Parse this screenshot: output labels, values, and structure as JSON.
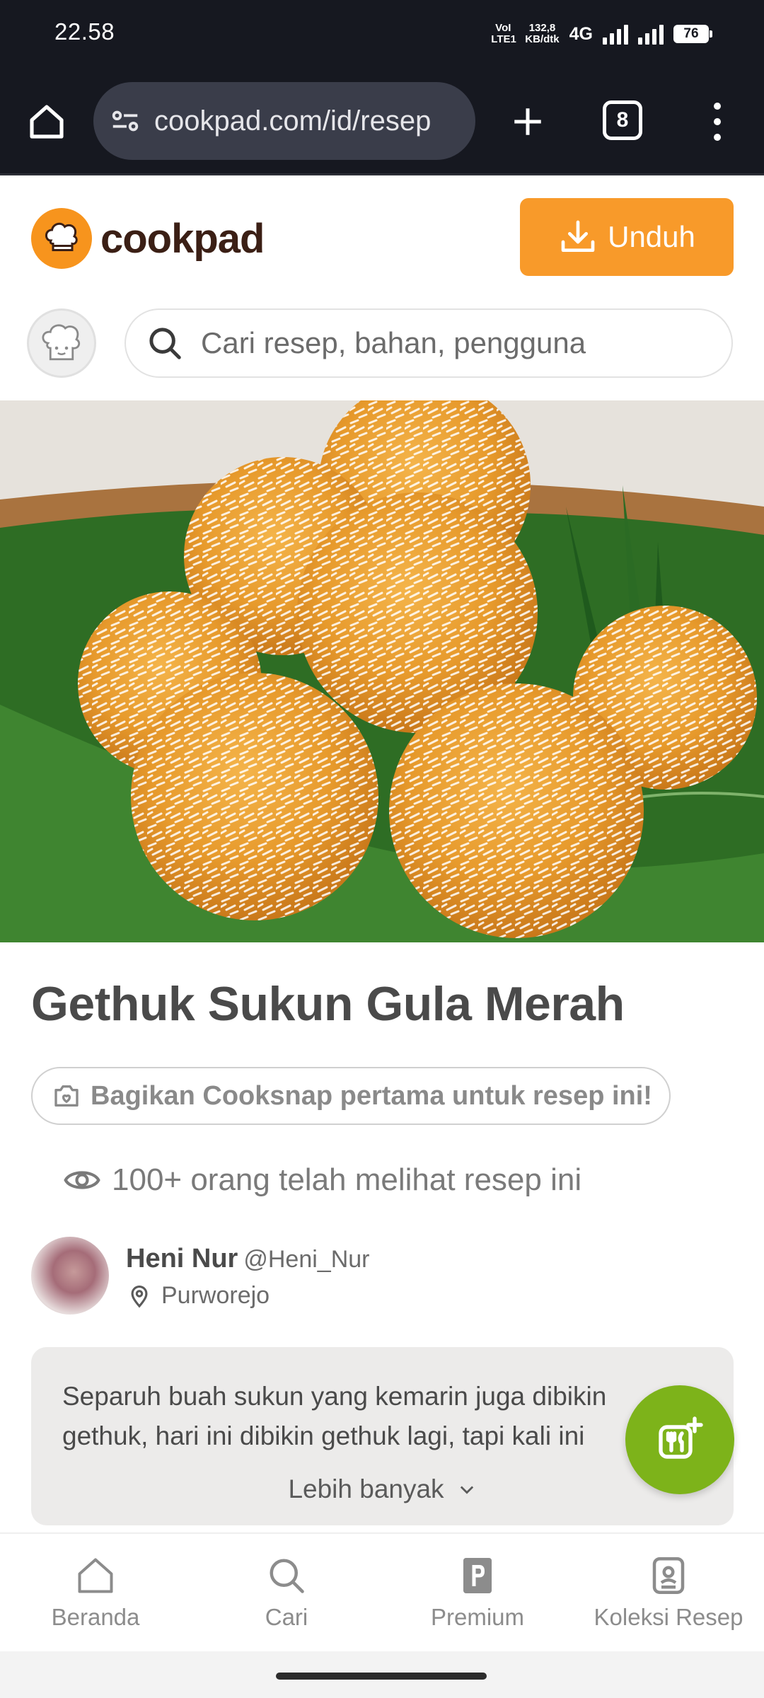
{
  "status_bar": {
    "time": "22.58",
    "volte": "VoI LTE1",
    "speed_value": "132,8",
    "speed_unit": "KB/dtk",
    "network": "4G",
    "battery": "76"
  },
  "browser": {
    "url": "cookpad.com/id/resep",
    "tab_count": "8"
  },
  "header": {
    "logo_text": "cookpad",
    "download_label": "Unduh",
    "search_placeholder": "Cari resep, bahan, pengguna"
  },
  "recipe": {
    "title": "Gethuk Sukun Gula Merah",
    "cooksnap_label": "Bagikan Cooksnap pertama untuk resep ini!",
    "views_text": "100+ orang telah melihat resep ini",
    "author": {
      "name": "Heni Nur",
      "handle": "@Heni_Nur",
      "location": "Purworejo"
    },
    "description": "Separuh buah sukun yang kemarin juga dibikin gethuk, hari ini dibikin gethuk lagi, tapi kali ini",
    "more_label": "Lebih banyak"
  },
  "bottom_nav": {
    "items": [
      {
        "label": "Beranda",
        "icon": "home-icon"
      },
      {
        "label": "Cari",
        "icon": "search-icon"
      },
      {
        "label": "Premium",
        "icon": "premium-icon"
      },
      {
        "label": "Koleksi Resep",
        "icon": "recipe-collection-icon"
      }
    ]
  },
  "colors": {
    "brand_orange": "#f89a2a",
    "fab_green": "#7db31a",
    "chrome_dark": "#161820"
  }
}
